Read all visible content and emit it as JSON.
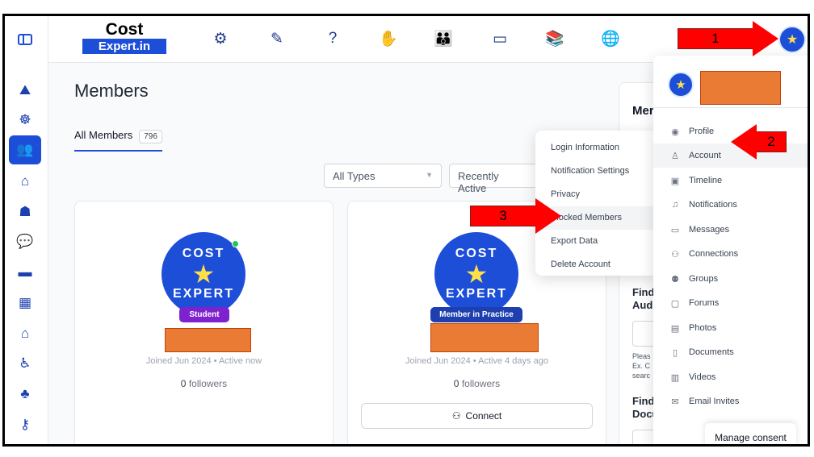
{
  "logo": {
    "line1": "Cost",
    "line2": "Expert.in"
  },
  "nav_icons": [
    "lightbulb-gear-icon",
    "pen-lines-icon",
    "question-idea-icon",
    "raised-hands-icon",
    "group-people-icon",
    "presentation-board-icon",
    "books-icon",
    "globe-icon"
  ],
  "rail_icons": [
    "activity-icon",
    "network-icon",
    "members-icon",
    "home-icon",
    "community-icon",
    "chat-icon",
    "briefcase-icon",
    "calendar-icon",
    "house-outline-icon",
    "person-cane-icon",
    "tree-icon",
    "key-icon"
  ],
  "page": {
    "title": "Members",
    "tab_label": "All Members",
    "tab_count": "796"
  },
  "filters": {
    "type": "All Types",
    "sort": "Recently Active"
  },
  "members": [
    {
      "role": "Student",
      "role_color": "#7e22ce",
      "joined": "Joined Jun 2024 • Active now",
      "followers_count": "0",
      "followers_label": "followers"
    },
    {
      "role": "Member in Practice",
      "role_color": "#1e40af",
      "joined": "Joined Jun 2024 • Active 4 days ago",
      "followers_count": "0",
      "followers_label": "followers",
      "connect_label": "Connect"
    }
  ],
  "badge": {
    "word1": "COST",
    "word2": "EXPERT"
  },
  "widget": {
    "title": "Mer",
    "heading1a": "Find",
    "heading1b": "Aud",
    "small1": "Pleas",
    "small2": "Ex. C",
    "small3": "searc",
    "heading2a": "Find",
    "heading2b": "Documentation Services"
  },
  "submenu": [
    "Login Information",
    "Notification Settings",
    "Privacy",
    "Blocked Members",
    "Export Data",
    "Delete Account"
  ],
  "profile_menu": [
    {
      "label": "Profile",
      "icon": "user-circle-icon"
    },
    {
      "label": "Account",
      "icon": "user-icon"
    },
    {
      "label": "Timeline",
      "icon": "timeline-icon"
    },
    {
      "label": "Notifications",
      "icon": "bell-icon"
    },
    {
      "label": "Messages",
      "icon": "inbox-icon"
    },
    {
      "label": "Connections",
      "icon": "users-icon"
    },
    {
      "label": "Groups",
      "icon": "groups-icon"
    },
    {
      "label": "Forums",
      "icon": "forum-icon"
    },
    {
      "label": "Photos",
      "icon": "photos-icon"
    },
    {
      "label": "Documents",
      "icon": "folder-icon"
    },
    {
      "label": "Videos",
      "icon": "film-icon"
    },
    {
      "label": "Email Invites",
      "icon": "envelope-icon"
    }
  ],
  "consent": "Manage consent",
  "callouts": [
    "1",
    "2",
    "3"
  ],
  "colors": {
    "brand": "#1d4ed8",
    "callout": "#ff0000",
    "redaction": "#ea7b35"
  }
}
